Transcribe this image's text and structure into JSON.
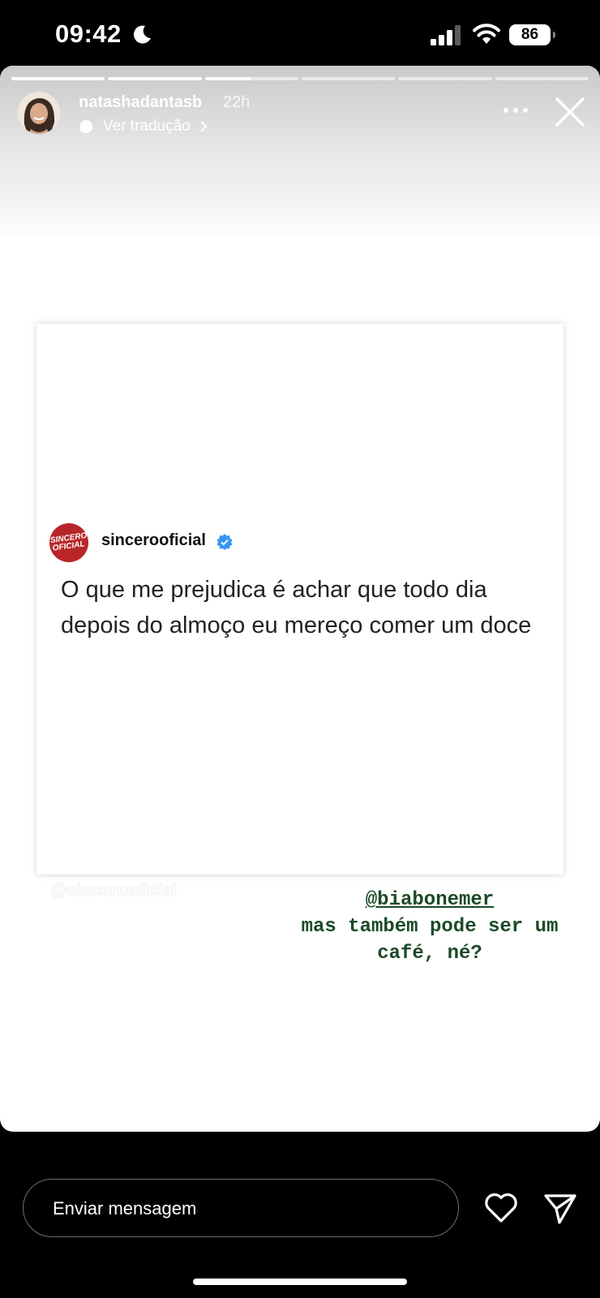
{
  "status_bar": {
    "time": "09:42",
    "battery_level": "86",
    "icons": [
      "moon-icon",
      "signal-icon",
      "wifi-icon",
      "battery-icon"
    ]
  },
  "story": {
    "segments_total": 6,
    "current_segment": 3,
    "current_segment_progress": 0.5,
    "username": "natashadantasb",
    "time_ago": "22h",
    "translate_label": "Ver tradução",
    "more_icon": "more-icon",
    "close_icon": "close-icon"
  },
  "post": {
    "logo_text_line1": "SINCERO",
    "logo_text_line2": "OFICIAL",
    "handle": "sincerooficial",
    "verified": true,
    "text": "O que me prejudica é achar que todo dia depois do almoço eu mereço comer um doce",
    "watermark": "@sincerooficial"
  },
  "mention_sticker": {
    "tag": "@biabonemer",
    "text": "mas também pode ser um café, né?"
  },
  "reply_bar": {
    "placeholder": "Enviar mensagem",
    "like_icon": "heart-icon",
    "send_icon": "send-icon"
  },
  "colors": {
    "background": "#000000",
    "story_bg": "#ffffff",
    "logo_red": "#b8262a",
    "mention_green": "#1c4a28",
    "verified_blue": "#3897f0"
  }
}
